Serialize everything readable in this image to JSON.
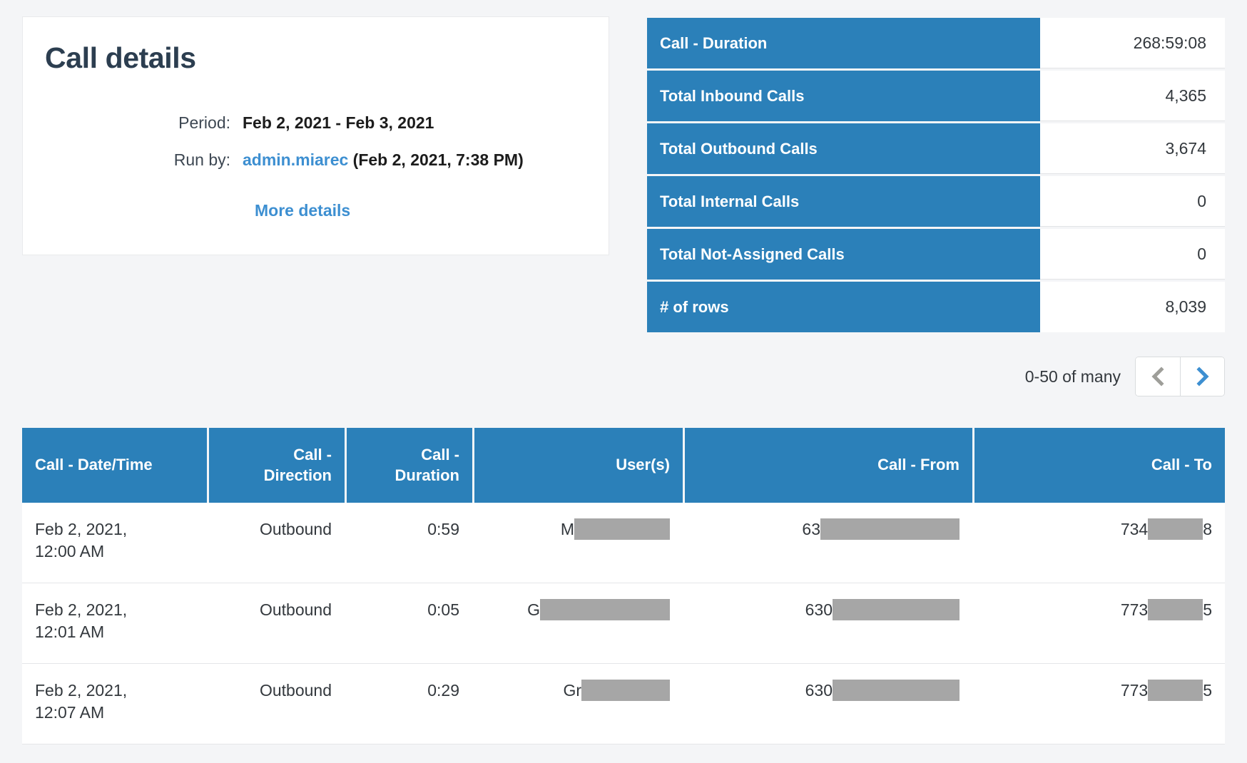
{
  "details_card": {
    "title": "Call details",
    "rows": [
      {
        "label": "Period:",
        "value": "Feb 2, 2021 - Feb 3, 2021"
      },
      {
        "label": "Run by:",
        "link": "admin.miarec",
        "suffix": " (Feb 2, 2021, 7:38 PM)"
      }
    ],
    "more_details_label": "More details"
  },
  "summary": {
    "rows": [
      {
        "key": "Call - Duration",
        "value": "268:59:08"
      },
      {
        "key": "Total Inbound Calls",
        "value": "4,365"
      },
      {
        "key": "Total Outbound Calls",
        "value": "3,674"
      },
      {
        "key": "Total Internal Calls",
        "value": "0"
      },
      {
        "key": "Total Not-Assigned Calls",
        "value": "0"
      },
      {
        "key": "# of rows",
        "value": "8,039"
      }
    ]
  },
  "pagination": {
    "range_text": "0-50 of many",
    "prev_icon": "chevron-left-icon",
    "next_icon": "chevron-right-icon",
    "prev_enabled": false,
    "next_enabled": true,
    "prev_color": "#9e9e99",
    "next_color": "#3d8fd1"
  },
  "table": {
    "headers": [
      {
        "label": "Call - Date/Time",
        "align": "left"
      },
      {
        "label": "Call - Direction",
        "align": "right"
      },
      {
        "label": "Call - Duration",
        "align": "right"
      },
      {
        "label": "User(s)",
        "align": "right"
      },
      {
        "label": "Call - From",
        "align": "right"
      },
      {
        "label": "Call - To",
        "align": "right"
      }
    ],
    "rows": [
      {
        "datetime": "Feb 2, 2021, 12:00 AM",
        "direction": "Outbound",
        "duration": "0:59",
        "user_prefix": "M",
        "user_redacted_width": 134,
        "from_prefix": "63",
        "from_redacted_width": 195,
        "from_suffix": "",
        "to_prefix": "734",
        "to_redacted_width": 77,
        "to_suffix": "8"
      },
      {
        "datetime": "Feb 2, 2021, 12:01 AM",
        "direction": "Outbound",
        "duration": "0:05",
        "user_prefix": "G",
        "user_redacted_width": 182,
        "from_prefix": "630",
        "from_redacted_width": 178,
        "from_suffix": "",
        "to_prefix": "773",
        "to_redacted_width": 77,
        "to_suffix": "5"
      },
      {
        "datetime": "Feb 2, 2021, 12:07 AM",
        "direction": "Outbound",
        "duration": "0:29",
        "user_prefix": "Gr",
        "user_redacted_width": 124,
        "from_prefix": "630",
        "from_redacted_width": 178,
        "from_suffix": "",
        "to_prefix": "773",
        "to_redacted_width": 77,
        "to_suffix": "5"
      }
    ]
  },
  "colors": {
    "accent_blue": "#2b80b9",
    "link_blue": "#3d8fd1",
    "title_navy": "#2c3e50",
    "page_bg": "#f4f5f7",
    "redaction_gray": "#a6a6a6"
  }
}
